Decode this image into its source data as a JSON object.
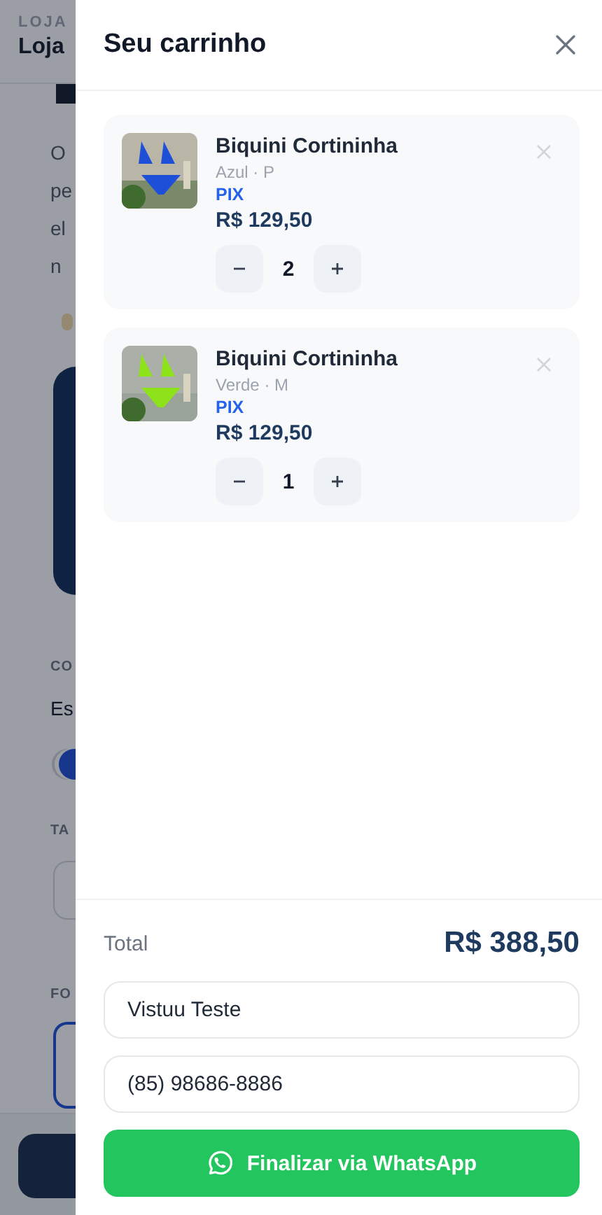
{
  "background": {
    "eyebrow": "LOJA",
    "title": "Loja",
    "paragraph_lines": [
      "O",
      "pe",
      "el",
      "n"
    ],
    "color_label": "CO",
    "color_value": "Es",
    "size_label": "TA",
    "form_label": "FO"
  },
  "cart": {
    "title": "Seu carrinho",
    "items": [
      {
        "name": "Biquini Cortininha",
        "variant": "Azul · P",
        "payment": "PIX",
        "price": "R$ 129,50",
        "quantity": "2"
      },
      {
        "name": "Biquini Cortininha",
        "variant": "Verde · M",
        "payment": "PIX",
        "price": "R$ 129,50",
        "quantity": "1"
      }
    ],
    "total_label": "Total",
    "total_value": "R$ 388,50",
    "name_field": {
      "value": "Vistuu Teste"
    },
    "phone_field": {
      "value": "(85) 98686-8886"
    },
    "checkout_button": "Finalizar via WhatsApp"
  }
}
